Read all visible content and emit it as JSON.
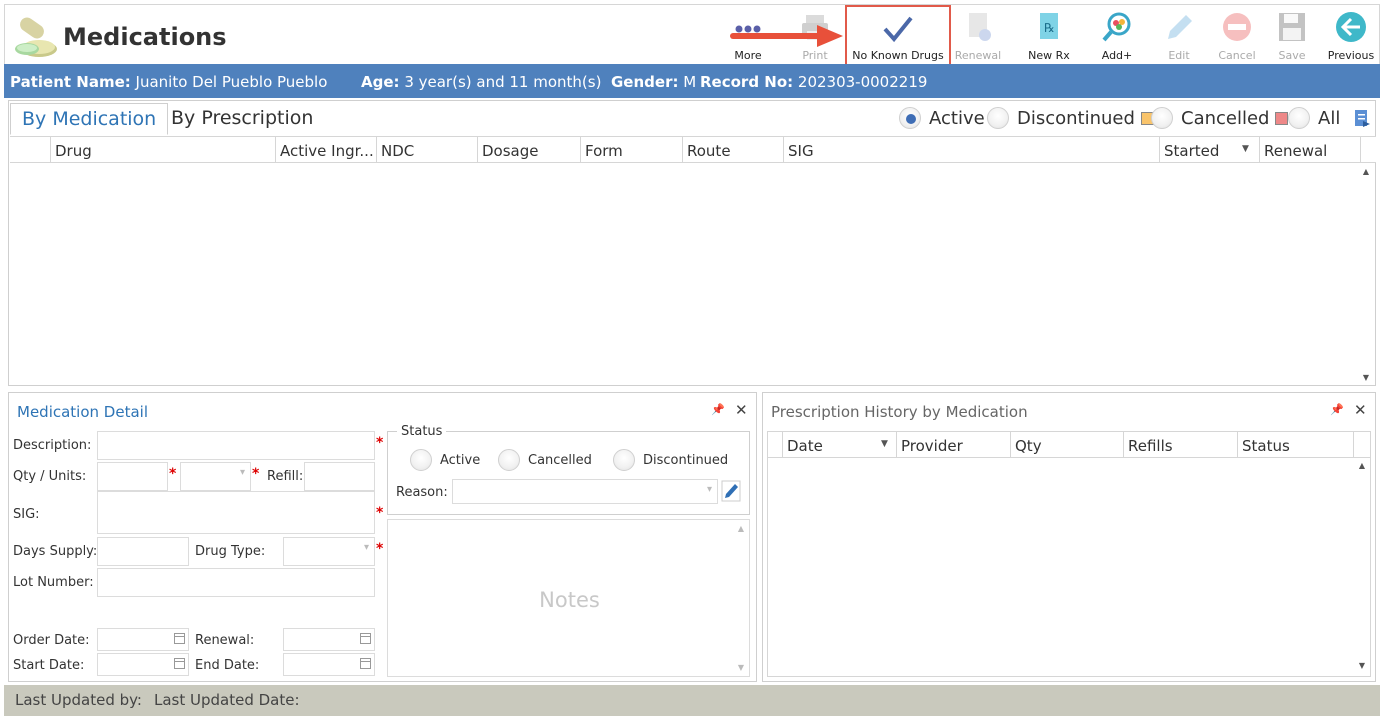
{
  "app": {
    "title": "Medications"
  },
  "toolbar": [
    {
      "id": "more",
      "label": "More",
      "icon": "more-dots-icon",
      "enabled": true
    },
    {
      "id": "print",
      "label": "Print",
      "icon": "printer-icon",
      "enabled": false
    },
    {
      "id": "no_known_drugs",
      "label": "No Known Drugs",
      "icon": "checkmark-icon",
      "enabled": true,
      "highlighted": true
    },
    {
      "id": "renewal",
      "label": "Renewal",
      "icon": "document-renew-icon",
      "enabled": false
    },
    {
      "id": "new_rx",
      "label": "New Rx",
      "icon": "rx-icon",
      "enabled": true
    },
    {
      "id": "add_plus",
      "label": "Add+",
      "icon": "search-pill-icon",
      "enabled": true
    },
    {
      "id": "edit",
      "label": "Edit",
      "icon": "pencil-icon",
      "enabled": false
    },
    {
      "id": "cancel",
      "label": "Cancel",
      "icon": "cancel-icon",
      "enabled": false
    },
    {
      "id": "save",
      "label": "Save",
      "icon": "floppy-disk-icon",
      "enabled": false
    },
    {
      "id": "previous",
      "label": "Previous",
      "icon": "back-arrow-icon",
      "enabled": true
    }
  ],
  "patient": {
    "name_label": "Patient Name:",
    "name": "Juanito Del Pueblo Pueblo",
    "age_label": "Age:",
    "age": "3 year(s) and 11 month(s)",
    "gender_label": "Gender:",
    "gender": "M",
    "record_label": "Record No:",
    "record": "202303-0002219"
  },
  "tabs": [
    "By Medication",
    "By Prescription"
  ],
  "filters": [
    {
      "label": "Active",
      "selected": true,
      "swatch": null
    },
    {
      "label": "Discontinued",
      "selected": false,
      "swatch": "#f9c46b"
    },
    {
      "label": "Cancelled",
      "selected": false,
      "swatch": "#ee8888"
    },
    {
      "label": "All",
      "selected": false,
      "swatch": null
    }
  ],
  "grid": {
    "columns": [
      "Drug",
      "Active Ingr...",
      "NDC",
      "Dosage",
      "Form",
      "Route",
      "SIG",
      "Started",
      "Renewal"
    ]
  },
  "detail": {
    "title": "Medication Detail",
    "labels": {
      "description": "Description:",
      "qty_units": "Qty / Units:",
      "refill": "Refill:",
      "sig": "SIG:",
      "days_supply": "Days Supply:",
      "drug_type": "Drug Type:",
      "lot_number": "Lot Number:",
      "order_date": "Order Date:",
      "renewal": "Renewal:",
      "start_date": "Start Date:",
      "end_date": "End Date:"
    },
    "status": {
      "legend": "Status",
      "options": [
        "Active",
        "Cancelled",
        "Discontinued"
      ],
      "reason_label": "Reason:"
    },
    "notes_placeholder": "Notes"
  },
  "history": {
    "title": "Prescription History by Medication",
    "columns": [
      "Date",
      "Provider",
      "Qty",
      "Refills",
      "Status"
    ]
  },
  "footer": {
    "last_updated_by": "Last Updated by:",
    "last_updated_date": "Last Updated Date:"
  },
  "colors": {
    "patient_bar": "#4f81bd",
    "highlight_border": "#e15a4a",
    "tab_active": "#2e74b5",
    "footer": "#c9c9bd"
  }
}
